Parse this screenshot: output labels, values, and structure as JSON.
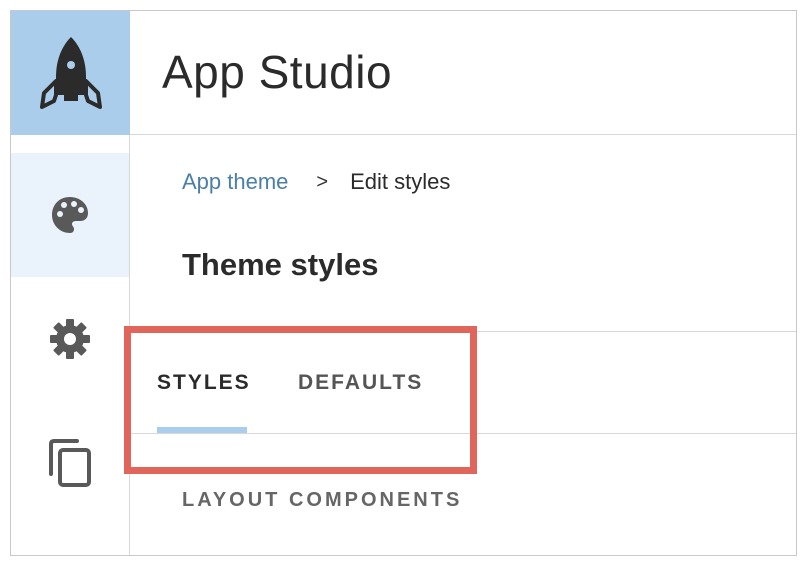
{
  "app": {
    "title": "App Studio"
  },
  "sidebar": {
    "items": [
      {
        "name": "theme",
        "icon": "palette-icon",
        "active": true
      },
      {
        "name": "settings",
        "icon": "gear-icon",
        "active": false
      },
      {
        "name": "pages",
        "icon": "copy-icon",
        "active": false
      }
    ]
  },
  "breadcrumb": {
    "parent": "App theme",
    "separator": ">",
    "current": "Edit styles"
  },
  "page": {
    "title": "Theme styles"
  },
  "tabs": [
    {
      "label": "STYLES",
      "active": true
    },
    {
      "label": "DEFAULTS",
      "active": false
    }
  ],
  "section": {
    "label": "LAYOUT COMPONENTS"
  },
  "colors": {
    "logo_bg": "#a9cdea",
    "active_sidebar_bg": "#eaf2fb",
    "link": "#4a7fa8",
    "tab_underline": "#a9cdea",
    "highlight": "#e0655a",
    "icon": "#595959"
  }
}
